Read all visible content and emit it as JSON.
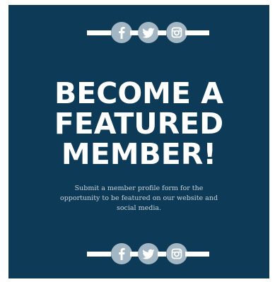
{
  "colors": {
    "background": "#0d3a56",
    "icon_circle": "#a3b6c3",
    "bar": "#ffffff",
    "headline": "#ffffff",
    "body_text": "#c9d3dc"
  },
  "social_icons": [
    "facebook-icon",
    "twitter-icon",
    "instagram-icon"
  ],
  "headline": {
    "line1": "BECOME A",
    "line2": "FEATURED",
    "line3": "MEMBER!"
  },
  "body": {
    "text": "Submit a member profile form for the opportunity to be featured on our website and social media."
  }
}
